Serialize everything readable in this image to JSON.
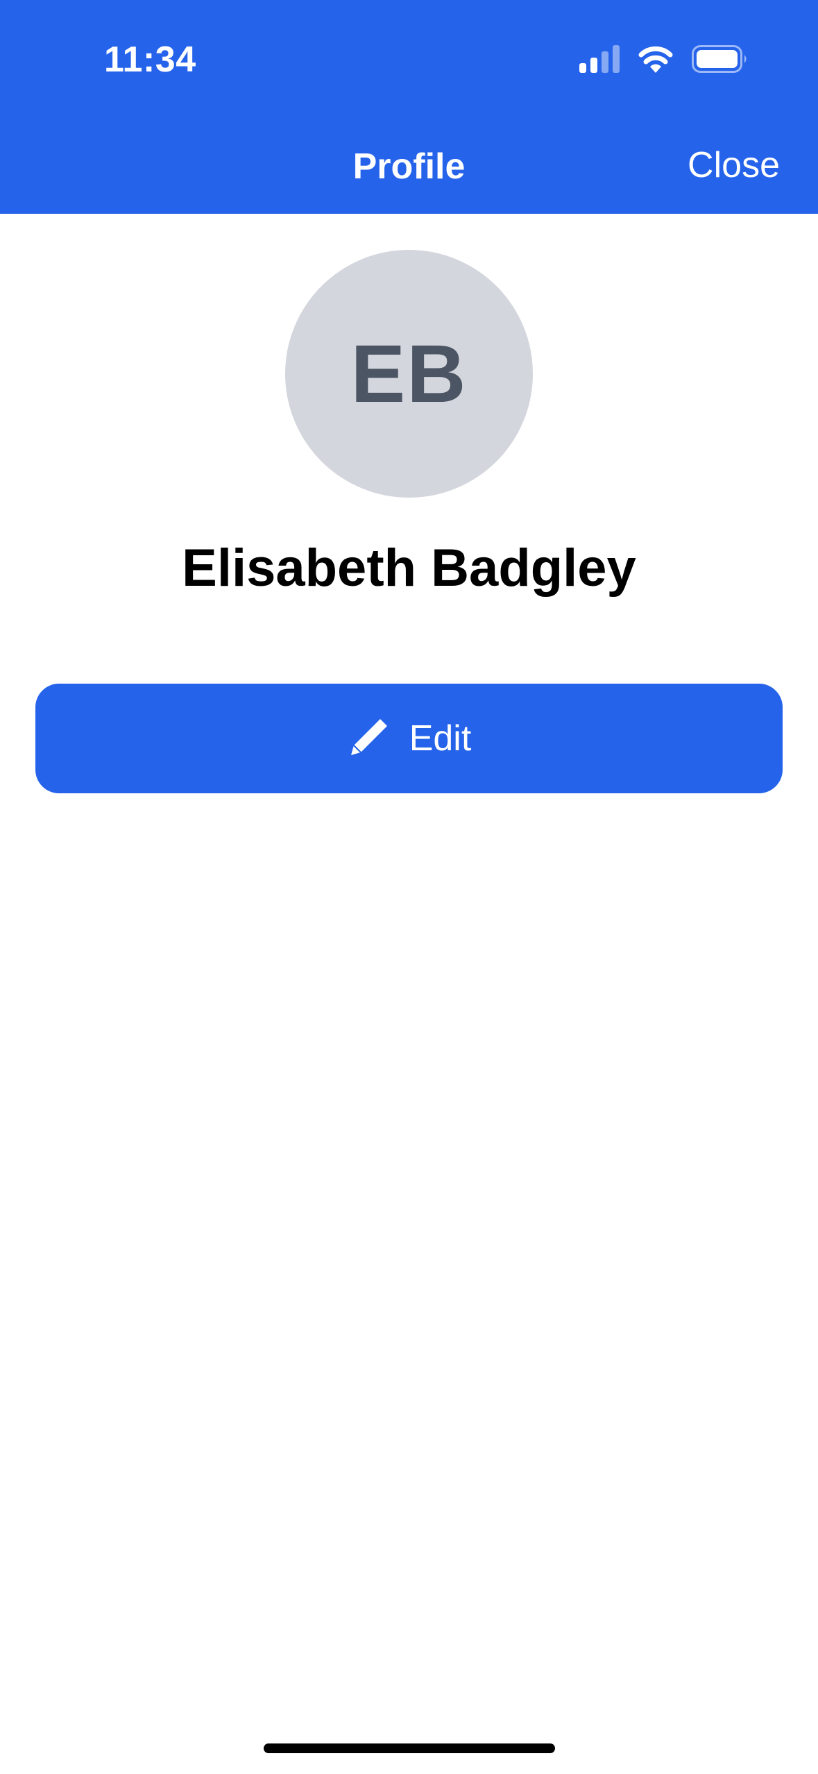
{
  "status_bar": {
    "time": "11:34",
    "signal_icon": "cellular-signal-icon",
    "wifi_icon": "wifi-icon",
    "battery_icon": "battery-icon"
  },
  "nav": {
    "title": "Profile",
    "close_label": "Close"
  },
  "profile": {
    "initials": "EB",
    "name": "Elisabeth Badgley"
  },
  "actions": {
    "edit_label": "Edit",
    "edit_icon": "pencil-icon"
  },
  "colors": {
    "accent": "#2563EB",
    "avatar_bg": "#D4D6DD",
    "avatar_text": "#4B5563",
    "text_primary": "#000000",
    "on_accent": "#FFFFFF"
  }
}
